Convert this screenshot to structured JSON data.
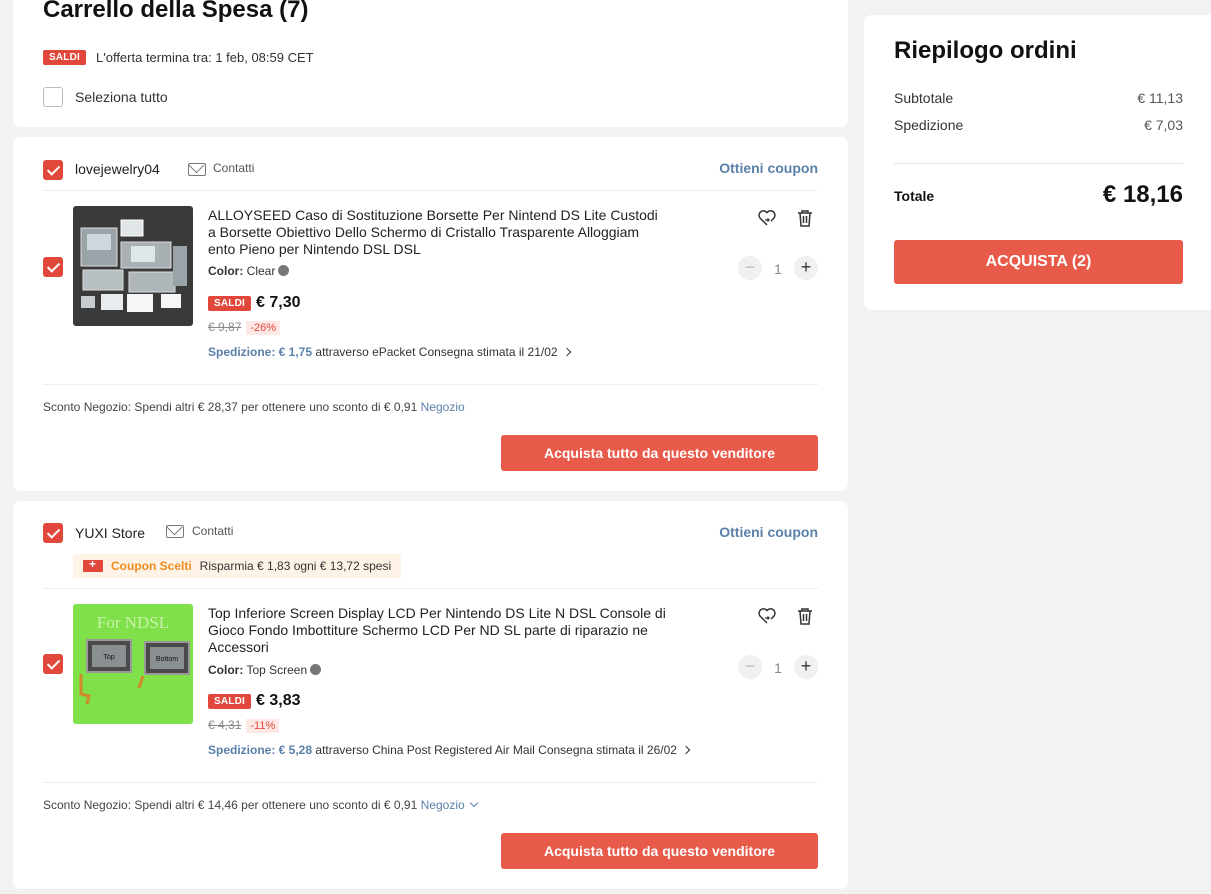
{
  "header": {
    "title": "Carrello della Spesa (7)",
    "saldi_badge": "SALDI",
    "offer_label": "L'offerta termina tra:",
    "offer_date": "1 feb, 08:59 CET",
    "select_all": "Seleziona tutto"
  },
  "stores": [
    {
      "name": "lovejewelry04",
      "contact": "Contatti",
      "coupon_link": "Ottieni coupon",
      "item": {
        "title": "ALLOYSEED Caso di Sostituzione Borsette Per Nintend DS Lite Custodi a Borsette Obiettivo Dello Schermo di Cristallo Trasparente Alloggiam ento Pieno per Nintendo DSL DSL",
        "color_label": "Color:",
        "color_value": "Clear",
        "saldi_badge": "SALDI",
        "price": "€ 7,30",
        "old_price": "€ 9,87",
        "discount": "-26%",
        "shipping_cost": "Spedizione: € 1,75",
        "shipping_method": "attraverso ePacket",
        "delivery": "Consegna stimata il 21/02",
        "quantity": "1"
      },
      "shop_discount": {
        "label": "Sconto Negozio:",
        "text": "Spendi altri € 28,37 per ottenere uno sconto di € 0,91",
        "link": "Negozio"
      },
      "buy_button": "Acquista tutto da questo venditore"
    },
    {
      "name": "YUXI Store",
      "contact": "Contatti",
      "coupon_link": "Ottieni coupon",
      "coupon_banner": {
        "label": "Coupon Scelti",
        "text": "Risparmia € 1,83 ogni € 13,72 spesi"
      },
      "item": {
        "title": "Top Inferiore Screen Display LCD Per Nintendo DS Lite N DSL Console di Gioco Fondo Imbottiture Schermo LCD Per ND SL parte di riparazio ne Accessori",
        "image_text": "For NDSL",
        "image_label_top": "Top",
        "image_label_bottom": "Bottom",
        "color_label": "Color:",
        "color_value": "Top Screen",
        "saldi_badge": "SALDI",
        "price": "€ 3,83",
        "old_price": "€ 4,31",
        "discount": "-11%",
        "shipping_cost": "Spedizione: € 5,28",
        "shipping_method": "attraverso China Post Registered Air Mail",
        "delivery": "Consegna stimata il 26/02",
        "quantity": "1"
      },
      "shop_discount": {
        "label": "Sconto Negozio:",
        "text": "Spendi altri € 14,46 per ottenere uno sconto di € 0,91",
        "link": "Negozio"
      },
      "buy_button": "Acquista tutto da questo venditore"
    }
  ],
  "summary": {
    "title": "Riepilogo ordini",
    "subtotal_label": "Subtotale",
    "subtotal_value": "€ 11,13",
    "shipping_label": "Spedizione",
    "shipping_value": "€ 7,03",
    "total_label": "Totale",
    "total_value": "€ 18,16",
    "checkout_button": "ACQUISTA (2)"
  },
  "colors": {
    "accent": "#e85a4a",
    "badge": "#e1473a",
    "link": "#5a7fa8",
    "coupon": "#f08c1e"
  }
}
